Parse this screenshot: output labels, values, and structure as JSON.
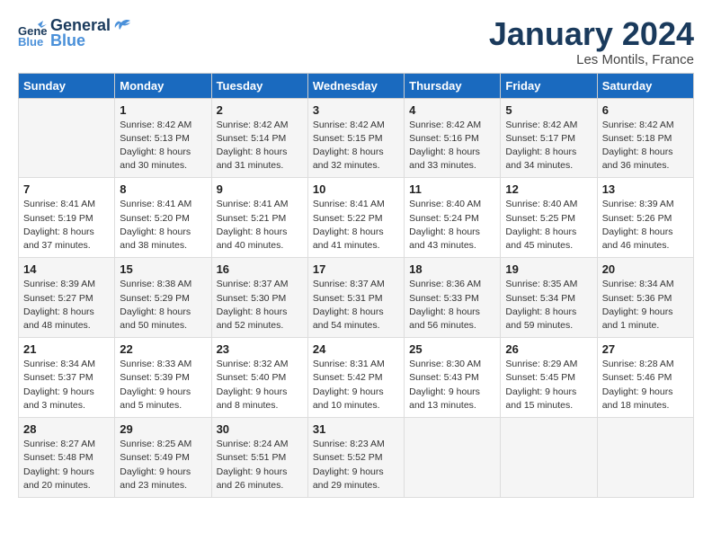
{
  "header": {
    "logo_general": "General",
    "logo_blue": "Blue",
    "title": "January 2024",
    "subtitle": "Les Montils, France"
  },
  "weekdays": [
    "Sunday",
    "Monday",
    "Tuesday",
    "Wednesday",
    "Thursday",
    "Friday",
    "Saturday"
  ],
  "weeks": [
    [
      {
        "day": "",
        "sunrise": "",
        "sunset": "",
        "daylight": ""
      },
      {
        "day": "1",
        "sunrise": "Sunrise: 8:42 AM",
        "sunset": "Sunset: 5:13 PM",
        "daylight": "Daylight: 8 hours and 30 minutes."
      },
      {
        "day": "2",
        "sunrise": "Sunrise: 8:42 AM",
        "sunset": "Sunset: 5:14 PM",
        "daylight": "Daylight: 8 hours and 31 minutes."
      },
      {
        "day": "3",
        "sunrise": "Sunrise: 8:42 AM",
        "sunset": "Sunset: 5:15 PM",
        "daylight": "Daylight: 8 hours and 32 minutes."
      },
      {
        "day": "4",
        "sunrise": "Sunrise: 8:42 AM",
        "sunset": "Sunset: 5:16 PM",
        "daylight": "Daylight: 8 hours and 33 minutes."
      },
      {
        "day": "5",
        "sunrise": "Sunrise: 8:42 AM",
        "sunset": "Sunset: 5:17 PM",
        "daylight": "Daylight: 8 hours and 34 minutes."
      },
      {
        "day": "6",
        "sunrise": "Sunrise: 8:42 AM",
        "sunset": "Sunset: 5:18 PM",
        "daylight": "Daylight: 8 hours and 36 minutes."
      }
    ],
    [
      {
        "day": "7",
        "sunrise": "Sunrise: 8:41 AM",
        "sunset": "Sunset: 5:19 PM",
        "daylight": "Daylight: 8 hours and 37 minutes."
      },
      {
        "day": "8",
        "sunrise": "Sunrise: 8:41 AM",
        "sunset": "Sunset: 5:20 PM",
        "daylight": "Daylight: 8 hours and 38 minutes."
      },
      {
        "day": "9",
        "sunrise": "Sunrise: 8:41 AM",
        "sunset": "Sunset: 5:21 PM",
        "daylight": "Daylight: 8 hours and 40 minutes."
      },
      {
        "day": "10",
        "sunrise": "Sunrise: 8:41 AM",
        "sunset": "Sunset: 5:22 PM",
        "daylight": "Daylight: 8 hours and 41 minutes."
      },
      {
        "day": "11",
        "sunrise": "Sunrise: 8:40 AM",
        "sunset": "Sunset: 5:24 PM",
        "daylight": "Daylight: 8 hours and 43 minutes."
      },
      {
        "day": "12",
        "sunrise": "Sunrise: 8:40 AM",
        "sunset": "Sunset: 5:25 PM",
        "daylight": "Daylight: 8 hours and 45 minutes."
      },
      {
        "day": "13",
        "sunrise": "Sunrise: 8:39 AM",
        "sunset": "Sunset: 5:26 PM",
        "daylight": "Daylight: 8 hours and 46 minutes."
      }
    ],
    [
      {
        "day": "14",
        "sunrise": "Sunrise: 8:39 AM",
        "sunset": "Sunset: 5:27 PM",
        "daylight": "Daylight: 8 hours and 48 minutes."
      },
      {
        "day": "15",
        "sunrise": "Sunrise: 8:38 AM",
        "sunset": "Sunset: 5:29 PM",
        "daylight": "Daylight: 8 hours and 50 minutes."
      },
      {
        "day": "16",
        "sunrise": "Sunrise: 8:37 AM",
        "sunset": "Sunset: 5:30 PM",
        "daylight": "Daylight: 8 hours and 52 minutes."
      },
      {
        "day": "17",
        "sunrise": "Sunrise: 8:37 AM",
        "sunset": "Sunset: 5:31 PM",
        "daylight": "Daylight: 8 hours and 54 minutes."
      },
      {
        "day": "18",
        "sunrise": "Sunrise: 8:36 AM",
        "sunset": "Sunset: 5:33 PM",
        "daylight": "Daylight: 8 hours and 56 minutes."
      },
      {
        "day": "19",
        "sunrise": "Sunrise: 8:35 AM",
        "sunset": "Sunset: 5:34 PM",
        "daylight": "Daylight: 8 hours and 59 minutes."
      },
      {
        "day": "20",
        "sunrise": "Sunrise: 8:34 AM",
        "sunset": "Sunset: 5:36 PM",
        "daylight": "Daylight: 9 hours and 1 minute."
      }
    ],
    [
      {
        "day": "21",
        "sunrise": "Sunrise: 8:34 AM",
        "sunset": "Sunset: 5:37 PM",
        "daylight": "Daylight: 9 hours and 3 minutes."
      },
      {
        "day": "22",
        "sunrise": "Sunrise: 8:33 AM",
        "sunset": "Sunset: 5:39 PM",
        "daylight": "Daylight: 9 hours and 5 minutes."
      },
      {
        "day": "23",
        "sunrise": "Sunrise: 8:32 AM",
        "sunset": "Sunset: 5:40 PM",
        "daylight": "Daylight: 9 hours and 8 minutes."
      },
      {
        "day": "24",
        "sunrise": "Sunrise: 8:31 AM",
        "sunset": "Sunset: 5:42 PM",
        "daylight": "Daylight: 9 hours and 10 minutes."
      },
      {
        "day": "25",
        "sunrise": "Sunrise: 8:30 AM",
        "sunset": "Sunset: 5:43 PM",
        "daylight": "Daylight: 9 hours and 13 minutes."
      },
      {
        "day": "26",
        "sunrise": "Sunrise: 8:29 AM",
        "sunset": "Sunset: 5:45 PM",
        "daylight": "Daylight: 9 hours and 15 minutes."
      },
      {
        "day": "27",
        "sunrise": "Sunrise: 8:28 AM",
        "sunset": "Sunset: 5:46 PM",
        "daylight": "Daylight: 9 hours and 18 minutes."
      }
    ],
    [
      {
        "day": "28",
        "sunrise": "Sunrise: 8:27 AM",
        "sunset": "Sunset: 5:48 PM",
        "daylight": "Daylight: 9 hours and 20 minutes."
      },
      {
        "day": "29",
        "sunrise": "Sunrise: 8:25 AM",
        "sunset": "Sunset: 5:49 PM",
        "daylight": "Daylight: 9 hours and 23 minutes."
      },
      {
        "day": "30",
        "sunrise": "Sunrise: 8:24 AM",
        "sunset": "Sunset: 5:51 PM",
        "daylight": "Daylight: 9 hours and 26 minutes."
      },
      {
        "day": "31",
        "sunrise": "Sunrise: 8:23 AM",
        "sunset": "Sunset: 5:52 PM",
        "daylight": "Daylight: 9 hours and 29 minutes."
      },
      {
        "day": "",
        "sunrise": "",
        "sunset": "",
        "daylight": ""
      },
      {
        "day": "",
        "sunrise": "",
        "sunset": "",
        "daylight": ""
      },
      {
        "day": "",
        "sunrise": "",
        "sunset": "",
        "daylight": ""
      }
    ]
  ]
}
